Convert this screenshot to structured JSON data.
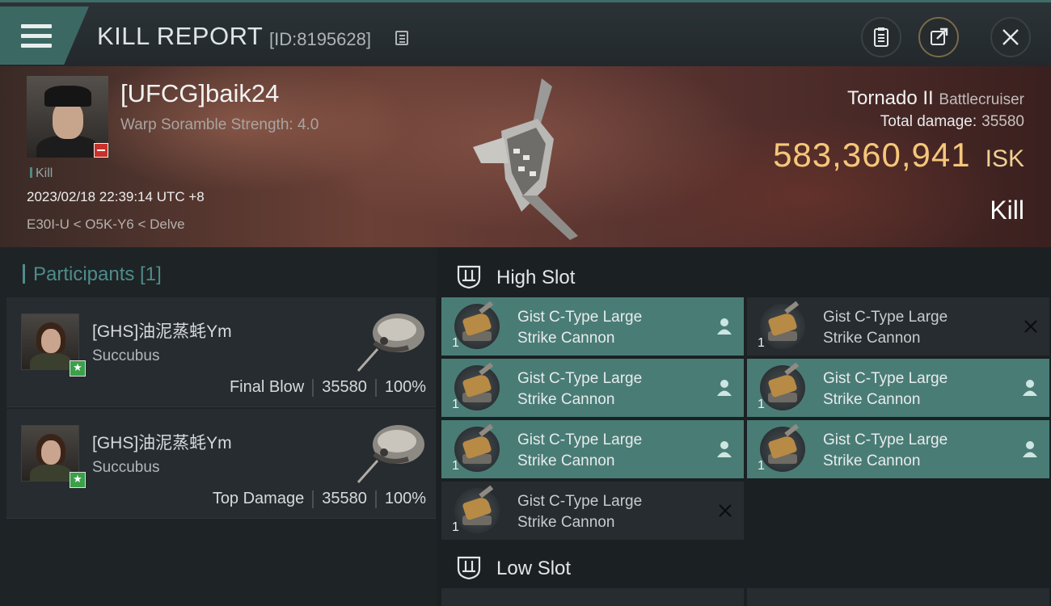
{
  "header": {
    "title": "KILL REPORT",
    "id_label": "[ID:8195628]"
  },
  "victim": {
    "name": "[UFCG]baik24",
    "subtitle": "Warp Soramble Strength: 4.0",
    "tag": "Kill",
    "datetime": "2023/02/18 22:39:14 UTC +8",
    "location": "E30I-U < O5K-Y6 < Delve",
    "ship_name": "Tornado II",
    "ship_class": "Battlecruiser",
    "total_damage_label": "Total damage:",
    "total_damage_value": "35580",
    "isk_value": "583,360,941",
    "isk_currency": "ISK",
    "result": "Kill"
  },
  "participants": {
    "title": "Participants [1]",
    "items": [
      {
        "name": "[GHS]油泥蒸蚝Ym",
        "ship": "Succubus",
        "role": "Final Blow",
        "damage": "35580",
        "percent": "100%"
      },
      {
        "name": "[GHS]油泥蒸蚝Ym",
        "ship": "Succubus",
        "role": "Top Damage",
        "damage": "35580",
        "percent": "100%"
      }
    ]
  },
  "high_slot": {
    "title": "High Slot",
    "modules": [
      {
        "line1": "Gist C-Type Large",
        "line2": "Strike Cannon",
        "qty": "1",
        "status": "dropped"
      },
      {
        "line1": "Gist C-Type Large",
        "line2": "Strike Cannon",
        "qty": "1",
        "status": "destroyed"
      },
      {
        "line1": "Gist C-Type Large",
        "line2": "Strike Cannon",
        "qty": "1",
        "status": "dropped"
      },
      {
        "line1": "Gist C-Type Large",
        "line2": "Strike Cannon",
        "qty": "1",
        "status": "dropped"
      },
      {
        "line1": "Gist C-Type Large",
        "line2": "Strike Cannon",
        "qty": "1",
        "status": "dropped"
      },
      {
        "line1": "Gist C-Type Large",
        "line2": "Strike Cannon",
        "qty": "1",
        "status": "dropped"
      },
      {
        "line1": "Gist C-Type Large",
        "line2": "Strike Cannon",
        "qty": "1",
        "status": "destroyed"
      }
    ]
  },
  "low_slot": {
    "title": "Low Slot"
  },
  "colors": {
    "accent_teal": "#4a7c76",
    "isk_gold": "#f5c77a",
    "badge_red": "#c8312a",
    "badge_green": "#3aa04a"
  },
  "icons": [
    "menu-icon",
    "copy-icon",
    "clipboard-icon",
    "share-icon",
    "close-icon",
    "slot-icon",
    "person-icon",
    "x-icon",
    "star-icon",
    "minus-icon"
  ]
}
